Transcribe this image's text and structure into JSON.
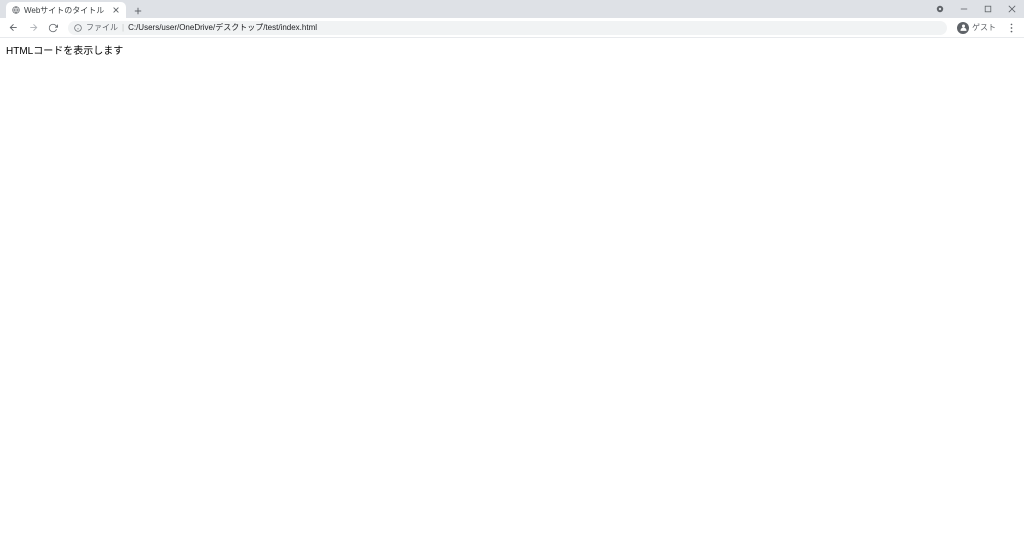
{
  "tab": {
    "title": "Webサイトのタイトル"
  },
  "omnibox": {
    "file_label": "ファイル",
    "url": "C:/Users/user/OneDrive/デスクトップ/test/index.html"
  },
  "profile": {
    "label": "ゲスト"
  },
  "page": {
    "body_text": "HTMLコードを表示します"
  }
}
